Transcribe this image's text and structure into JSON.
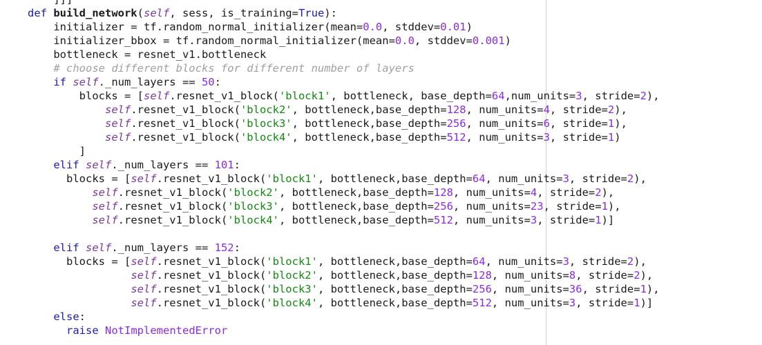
{
  "code": {
    "lines": [
      {
        "tokens": [
          {
            "t": "    ]]]",
            "c": ""
          }
        ]
      },
      {
        "tokens": [
          {
            "t": "def ",
            "c": "kw"
          },
          {
            "t": "build_network",
            "c": "fn"
          },
          {
            "t": "(",
            "c": ""
          },
          {
            "t": "self",
            "c": "self"
          },
          {
            "t": ", sess, is_training=",
            "c": ""
          },
          {
            "t": "True",
            "c": "kw"
          },
          {
            "t": "):",
            "c": ""
          }
        ]
      },
      {
        "tokens": [
          {
            "t": "    initializer = tf.random_normal_initializer(mean=",
            "c": ""
          },
          {
            "t": "0.0",
            "c": "num"
          },
          {
            "t": ", stddev=",
            "c": ""
          },
          {
            "t": "0.01",
            "c": "num"
          },
          {
            "t": ")",
            "c": ""
          }
        ]
      },
      {
        "tokens": [
          {
            "t": "    initializer_bbox = tf.random_normal_initializer(mean=",
            "c": ""
          },
          {
            "t": "0.0",
            "c": "num"
          },
          {
            "t": ", stddev=",
            "c": ""
          },
          {
            "t": "0.001",
            "c": "num"
          },
          {
            "t": ")",
            "c": ""
          }
        ]
      },
      {
        "tokens": [
          {
            "t": "    bottleneck = resnet_v1.bottleneck",
            "c": ""
          }
        ]
      },
      {
        "tokens": [
          {
            "t": "    ",
            "c": ""
          },
          {
            "t": "# choose different blocks for different number of layers",
            "c": "cm"
          }
        ]
      },
      {
        "tokens": [
          {
            "t": "    ",
            "c": ""
          },
          {
            "t": "if ",
            "c": "kw"
          },
          {
            "t": "self",
            "c": "self"
          },
          {
            "t": "._num_layers == ",
            "c": ""
          },
          {
            "t": "50",
            "c": "num"
          },
          {
            "t": ":",
            "c": ""
          }
        ]
      },
      {
        "tokens": [
          {
            "t": "        blocks = [",
            "c": ""
          },
          {
            "t": "self",
            "c": "self"
          },
          {
            "t": ".resnet_v1_block(",
            "c": ""
          },
          {
            "t": "'block1'",
            "c": "str"
          },
          {
            "t": ", bottleneck, base_depth=",
            "c": ""
          },
          {
            "t": "64",
            "c": "num"
          },
          {
            "t": ",num_units=",
            "c": ""
          },
          {
            "t": "3",
            "c": "num"
          },
          {
            "t": ", stride=",
            "c": ""
          },
          {
            "t": "2",
            "c": "num"
          },
          {
            "t": "),",
            "c": ""
          }
        ]
      },
      {
        "tokens": [
          {
            "t": "            ",
            "c": ""
          },
          {
            "t": "self",
            "c": "self"
          },
          {
            "t": ".resnet_v1_block(",
            "c": ""
          },
          {
            "t": "'block2'",
            "c": "str"
          },
          {
            "t": ", bottleneck,base_depth=",
            "c": ""
          },
          {
            "t": "128",
            "c": "num"
          },
          {
            "t": ", num_units=",
            "c": ""
          },
          {
            "t": "4",
            "c": "num"
          },
          {
            "t": ", stride=",
            "c": ""
          },
          {
            "t": "2",
            "c": "num"
          },
          {
            "t": "),",
            "c": ""
          }
        ]
      },
      {
        "tokens": [
          {
            "t": "            ",
            "c": ""
          },
          {
            "t": "self",
            "c": "self"
          },
          {
            "t": ".resnet_v1_block(",
            "c": ""
          },
          {
            "t": "'block3'",
            "c": "str"
          },
          {
            "t": ", bottleneck,base_depth=",
            "c": ""
          },
          {
            "t": "256",
            "c": "num"
          },
          {
            "t": ", num_units=",
            "c": ""
          },
          {
            "t": "6",
            "c": "num"
          },
          {
            "t": ", stride=",
            "c": ""
          },
          {
            "t": "1",
            "c": "num"
          },
          {
            "t": "),",
            "c": ""
          }
        ]
      },
      {
        "tokens": [
          {
            "t": "            ",
            "c": ""
          },
          {
            "t": "self",
            "c": "self"
          },
          {
            "t": ".resnet_v1_block(",
            "c": ""
          },
          {
            "t": "'block4'",
            "c": "str"
          },
          {
            "t": ", bottleneck,base_depth=",
            "c": ""
          },
          {
            "t": "512",
            "c": "num"
          },
          {
            "t": ", num_units=",
            "c": ""
          },
          {
            "t": "3",
            "c": "num"
          },
          {
            "t": ", stride=",
            "c": ""
          },
          {
            "t": "1",
            "c": "num"
          },
          {
            "t": ")",
            "c": ""
          }
        ]
      },
      {
        "tokens": [
          {
            "t": "        ]",
            "c": ""
          }
        ]
      },
      {
        "tokens": [
          {
            "t": "    ",
            "c": ""
          },
          {
            "t": "elif ",
            "c": "kw"
          },
          {
            "t": "self",
            "c": "self"
          },
          {
            "t": "._num_layers == ",
            "c": ""
          },
          {
            "t": "101",
            "c": "num"
          },
          {
            "t": ":",
            "c": ""
          }
        ]
      },
      {
        "tokens": [
          {
            "t": "      blocks = [",
            "c": ""
          },
          {
            "t": "self",
            "c": "self"
          },
          {
            "t": ".resnet_v1_block(",
            "c": ""
          },
          {
            "t": "'block1'",
            "c": "str"
          },
          {
            "t": ", bottleneck,base_depth=",
            "c": ""
          },
          {
            "t": "64",
            "c": "num"
          },
          {
            "t": ", num_units=",
            "c": ""
          },
          {
            "t": "3",
            "c": "num"
          },
          {
            "t": ", stride=",
            "c": ""
          },
          {
            "t": "2",
            "c": "num"
          },
          {
            "t": "),",
            "c": ""
          }
        ]
      },
      {
        "tokens": [
          {
            "t": "          ",
            "c": ""
          },
          {
            "t": "self",
            "c": "self"
          },
          {
            "t": ".resnet_v1_block(",
            "c": ""
          },
          {
            "t": "'block2'",
            "c": "str"
          },
          {
            "t": ", bottleneck,base_depth=",
            "c": ""
          },
          {
            "t": "128",
            "c": "num"
          },
          {
            "t": ", num_units=",
            "c": ""
          },
          {
            "t": "4",
            "c": "num"
          },
          {
            "t": ", stride=",
            "c": ""
          },
          {
            "t": "2",
            "c": "num"
          },
          {
            "t": "),",
            "c": ""
          }
        ]
      },
      {
        "tokens": [
          {
            "t": "          ",
            "c": ""
          },
          {
            "t": "self",
            "c": "self"
          },
          {
            "t": ".resnet_v1_block(",
            "c": ""
          },
          {
            "t": "'block3'",
            "c": "str"
          },
          {
            "t": ", bottleneck,base_depth=",
            "c": ""
          },
          {
            "t": "256",
            "c": "num"
          },
          {
            "t": ", num_units=",
            "c": ""
          },
          {
            "t": "23",
            "c": "num"
          },
          {
            "t": ", stride=",
            "c": ""
          },
          {
            "t": "1",
            "c": "num"
          },
          {
            "t": "),",
            "c": ""
          }
        ]
      },
      {
        "tokens": [
          {
            "t": "          ",
            "c": ""
          },
          {
            "t": "self",
            "c": "self"
          },
          {
            "t": ".resnet_v1_block(",
            "c": ""
          },
          {
            "t": "'block4'",
            "c": "str"
          },
          {
            "t": ", bottleneck,base_depth=",
            "c": ""
          },
          {
            "t": "512",
            "c": "num"
          },
          {
            "t": ", num_units=",
            "c": ""
          },
          {
            "t": "3",
            "c": "num"
          },
          {
            "t": ", stride=",
            "c": ""
          },
          {
            "t": "1",
            "c": "num"
          },
          {
            "t": ")]",
            "c": ""
          }
        ]
      },
      {
        "tokens": [
          {
            "t": "",
            "c": ""
          }
        ]
      },
      {
        "tokens": [
          {
            "t": "    ",
            "c": ""
          },
          {
            "t": "elif ",
            "c": "kw"
          },
          {
            "t": "self",
            "c": "self"
          },
          {
            "t": "._num_layers == ",
            "c": ""
          },
          {
            "t": "152",
            "c": "num"
          },
          {
            "t": ":",
            "c": ""
          }
        ]
      },
      {
        "tokens": [
          {
            "t": "      blocks = [",
            "c": ""
          },
          {
            "t": "self",
            "c": "self"
          },
          {
            "t": ".resnet_v1_block(",
            "c": ""
          },
          {
            "t": "'block1'",
            "c": "str"
          },
          {
            "t": ", bottleneck,base_depth=",
            "c": ""
          },
          {
            "t": "64",
            "c": "num"
          },
          {
            "t": ", num_units=",
            "c": ""
          },
          {
            "t": "3",
            "c": "num"
          },
          {
            "t": ", stride=",
            "c": ""
          },
          {
            "t": "2",
            "c": "num"
          },
          {
            "t": "),",
            "c": ""
          }
        ]
      },
      {
        "tokens": [
          {
            "t": "                ",
            "c": ""
          },
          {
            "t": "self",
            "c": "self"
          },
          {
            "t": ".resnet_v1_block(",
            "c": ""
          },
          {
            "t": "'block2'",
            "c": "str"
          },
          {
            "t": ", bottleneck,base_depth=",
            "c": ""
          },
          {
            "t": "128",
            "c": "num"
          },
          {
            "t": ", num_units=",
            "c": ""
          },
          {
            "t": "8",
            "c": "num"
          },
          {
            "t": ", stride=",
            "c": ""
          },
          {
            "t": "2",
            "c": "num"
          },
          {
            "t": "),",
            "c": ""
          }
        ]
      },
      {
        "tokens": [
          {
            "t": "                ",
            "c": ""
          },
          {
            "t": "self",
            "c": "self"
          },
          {
            "t": ".resnet_v1_block(",
            "c": ""
          },
          {
            "t": "'block3'",
            "c": "str"
          },
          {
            "t": ", bottleneck,base_depth=",
            "c": ""
          },
          {
            "t": "256",
            "c": "num"
          },
          {
            "t": ", num_units=",
            "c": ""
          },
          {
            "t": "36",
            "c": "num"
          },
          {
            "t": ", stride=",
            "c": ""
          },
          {
            "t": "1",
            "c": "num"
          },
          {
            "t": "),",
            "c": ""
          }
        ]
      },
      {
        "tokens": [
          {
            "t": "                ",
            "c": ""
          },
          {
            "t": "self",
            "c": "self"
          },
          {
            "t": ".resnet_v1_block(",
            "c": ""
          },
          {
            "t": "'block4'",
            "c": "str"
          },
          {
            "t": ", bottleneck,base_depth=",
            "c": ""
          },
          {
            "t": "512",
            "c": "num"
          },
          {
            "t": ", num_units=",
            "c": ""
          },
          {
            "t": "3",
            "c": "num"
          },
          {
            "t": ", stride=",
            "c": ""
          },
          {
            "t": "1",
            "c": "num"
          },
          {
            "t": ")]",
            "c": ""
          }
        ]
      },
      {
        "tokens": [
          {
            "t": "    ",
            "c": ""
          },
          {
            "t": "else",
            "c": "kw"
          },
          {
            "t": ":",
            "c": ""
          }
        ]
      },
      {
        "tokens": [
          {
            "t": "      ",
            "c": ""
          },
          {
            "t": "raise ",
            "c": "kw"
          },
          {
            "t": "NotImplementedError",
            "c": "exc"
          }
        ]
      }
    ]
  }
}
